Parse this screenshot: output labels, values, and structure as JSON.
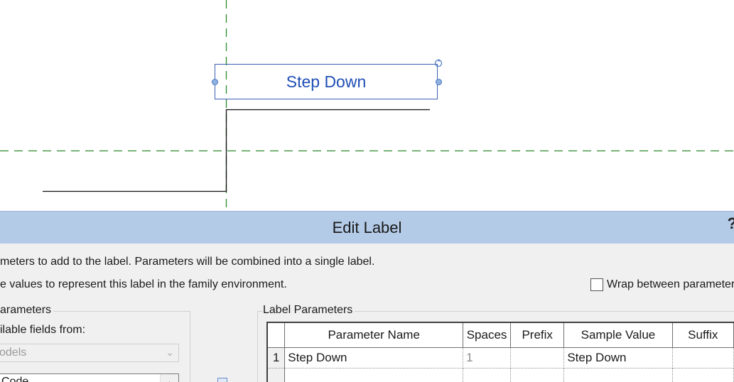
{
  "canvas": {
    "label_text": "Step Down",
    "colors": {
      "label": "#1f4fb5",
      "reference_line": "#2e8b2e",
      "grip": "#8fb2e0"
    }
  },
  "dialog": {
    "title": "Edit Label",
    "help_glyph": "?",
    "instruction_1": "meters to add to the label.  Parameters will be combined into a single label.",
    "instruction_2": "e values to represent this label in the family environment.",
    "wrap_checkbox_label": "Wrap between parameters only",
    "wrap_checked": false,
    "left_group_title": "arameters",
    "fields_from_label": "ilable fields from:",
    "category_combo_value": "odels",
    "field_list_first_item": "Code",
    "right_group_title": "Label Parameters",
    "table": {
      "columns": [
        "Parameter Name",
        "Spaces",
        "Prefix",
        "Sample Value",
        "Suffix"
      ],
      "rows": [
        {
          "num": "1",
          "parameter_name": "Step Down",
          "spaces": "1",
          "prefix": "",
          "sample_value": "Step Down",
          "suffix": ""
        },
        {
          "num": "",
          "parameter_name": "",
          "spaces": "",
          "prefix": "",
          "sample_value": "",
          "suffix": ""
        }
      ]
    }
  }
}
